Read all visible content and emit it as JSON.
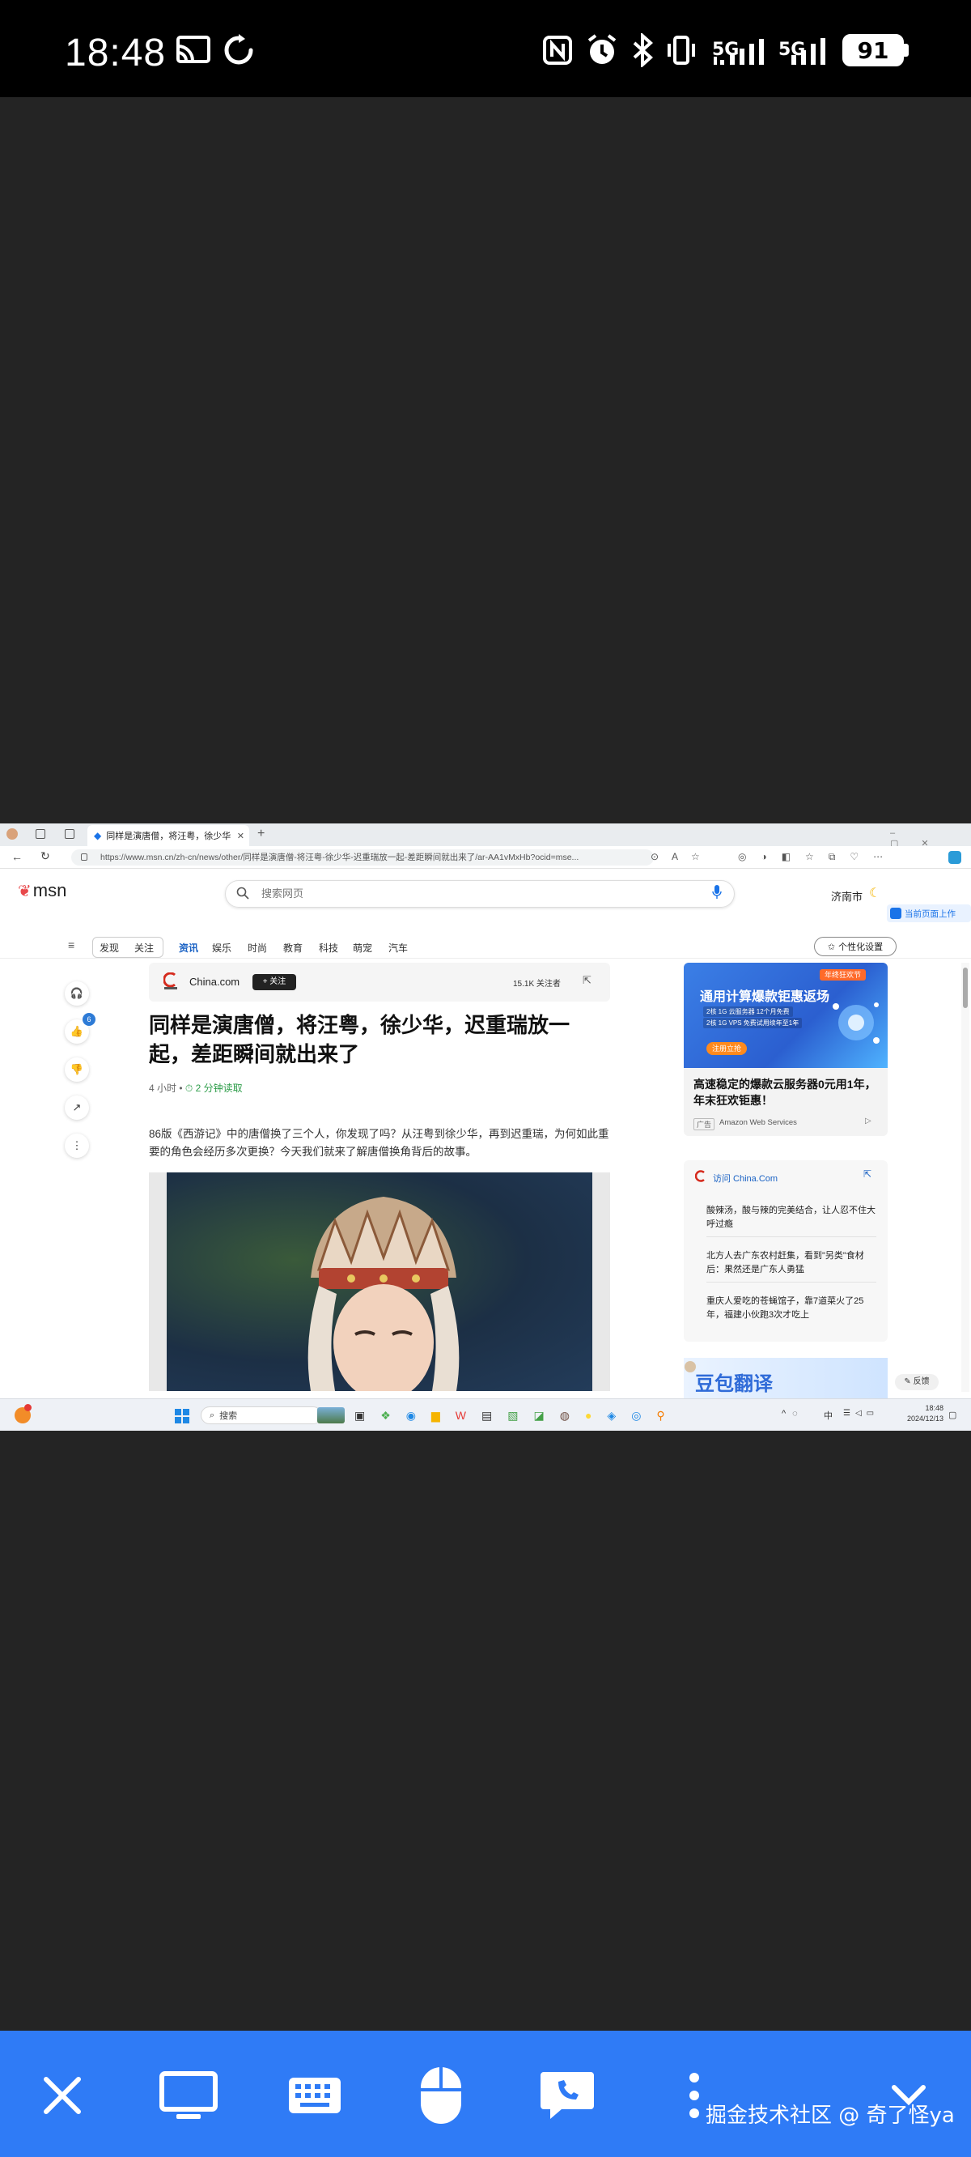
{
  "status_bar": {
    "time": "18:48",
    "network_1": "5G",
    "network_2": "5G",
    "battery": "91"
  },
  "browser": {
    "tab_title": "同样是演唐僧，将汪粤，徐少华",
    "url": "https://www.msn.cn/zh-cn/news/other/同样是演唐僧-将汪粤-徐少华-迟重瑞放一起-差距瞬间就出来了/ar-AA1vMxHb?ocid=mse..."
  },
  "msn": {
    "logo_text": "msn",
    "search_placeholder": "搜索网页",
    "location": "济南市",
    "side_button": "当前页面上作",
    "nav": [
      "发现",
      "关注",
      "资讯",
      "娱乐",
      "时尚",
      "教育",
      "科技",
      "萌宠",
      "汽车"
    ],
    "personalize": "个性化设置"
  },
  "actions": {
    "like_count": "6"
  },
  "article": {
    "source_name": "China.com",
    "follow_button": "+ 关注",
    "followers": "15.1K 关注者",
    "headline": "同样是演唐僧，将汪粤，徐少华，迟重瑞放一起，差距瞬间就出来了",
    "time_ago": "4 小时",
    "read_time": "2 分钟读取",
    "summary": "86版《西游记》中的唐僧换了三个人，你发现了吗？从汪粤到徐少华，再到迟重瑞，为何如此重要的角色会经历多次更换？今天我们就来了解唐僧换角背后的故事。"
  },
  "ad": {
    "banner_badge": "年终狂欢节",
    "banner_title": "通用计算爆款钜惠返场",
    "banner_line1": "2核 1G 云服务器 12个月免费",
    "banner_line2": "2核 1G VPS 免费试用续年至1年",
    "banner_cta": "注册立抢",
    "title": "高速稳定的爆款云服务器0元用1年，年末狂欢钜惠！",
    "ad_label": "广告",
    "advertiser": "Amazon Web Services"
  },
  "side_card": {
    "visit_label": "访问 China.Com",
    "items": [
      "酸辣汤，酸与辣的完美结合，让人忍不住大呼过瘾",
      "北方人去广东农村赶集，看到\"另类\"食材后：果然还是广东人勇猛",
      "重庆人爱吃的苍蝇馆子，靠7道菜火了25年，福建小伙跑3次才吃上"
    ]
  },
  "promo": {
    "text": "豆包翻译",
    "feedback": "反馈"
  },
  "taskbar": {
    "search": "搜索",
    "ime": "中",
    "time": "18:48",
    "date": "2024/12/13"
  },
  "controls": {
    "watermark": "掘金技术社区 @ 奇了怪ya"
  }
}
